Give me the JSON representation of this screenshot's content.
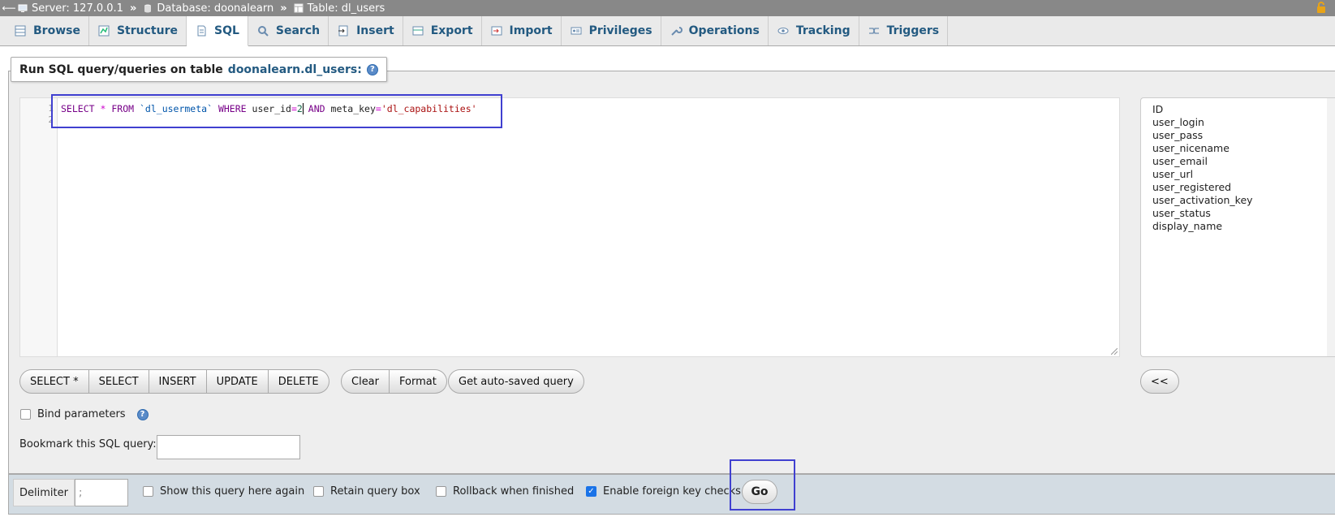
{
  "breadcrumb": {
    "server": "Server: 127.0.0.1",
    "database": "Database: doonalearn",
    "table": "Table: dl_users",
    "separator": "»"
  },
  "tabs": [
    {
      "label": "Browse",
      "icon": "browse-icon"
    },
    {
      "label": "Structure",
      "icon": "structure-icon"
    },
    {
      "label": "SQL",
      "icon": "sql-icon",
      "active": true
    },
    {
      "label": "Search",
      "icon": "search-icon"
    },
    {
      "label": "Insert",
      "icon": "insert-icon"
    },
    {
      "label": "Export",
      "icon": "export-icon"
    },
    {
      "label": "Import",
      "icon": "import-icon"
    },
    {
      "label": "Privileges",
      "icon": "privileges-icon"
    },
    {
      "label": "Operations",
      "icon": "wrench-icon"
    },
    {
      "label": "Tracking",
      "icon": "eye-icon"
    },
    {
      "label": "Triggers",
      "icon": "triggers-icon"
    }
  ],
  "panel": {
    "legend_prefix": "Run SQL query/queries on table",
    "legend_table": "doonalearn.dl_users:"
  },
  "editor": {
    "line_numbers": [
      "1",
      "2"
    ],
    "query": {
      "kw_select": "SELECT",
      "star": "*",
      "kw_from": "FROM",
      "table": "`dl_usermeta`",
      "kw_where": "WHERE",
      "col1": "user_id",
      "eq1": "=",
      "val1": "2",
      "kw_and": "AND",
      "col2": "meta_key",
      "eq2": "=",
      "val2": "'dl_capabilities'"
    }
  },
  "columns": [
    "ID",
    "user_login",
    "user_pass",
    "user_nicename",
    "user_email",
    "user_url",
    "user_registered",
    "user_activation_key",
    "user_status",
    "display_name"
  ],
  "buttons": {
    "select_star": "SELECT *",
    "select": "SELECT",
    "insert": "INSERT",
    "update": "UPDATE",
    "delete": "DELETE",
    "clear": "Clear",
    "format": "Format",
    "auto_saved": "Get auto-saved query",
    "collapse": "<<"
  },
  "options": {
    "bind_parameters": "Bind parameters",
    "bookmark_label": "Bookmark this SQL query:",
    "bookmark_value": ""
  },
  "footer": {
    "delimiter_label": "Delimiter",
    "delimiter_value": ";",
    "show_query": "Show this query here again",
    "retain_box": "Retain query box",
    "rollback": "Rollback when finished",
    "foreign_keys": "Enable foreign key checks",
    "go": "Go"
  },
  "colors": {
    "accent": "#235a81",
    "highlight": "#4040d0",
    "checked": "#1a73e8"
  }
}
